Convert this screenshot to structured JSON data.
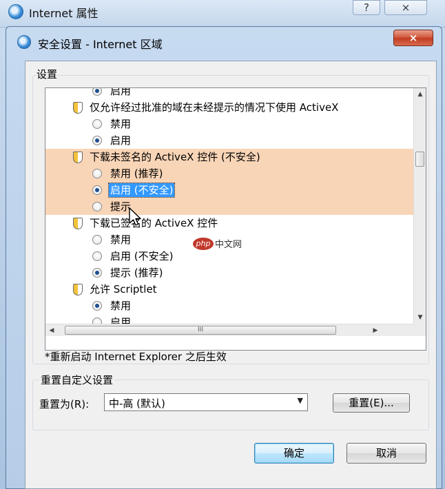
{
  "parent_window": {
    "title": "Internet 属性",
    "help_label": "?",
    "close_label": "×"
  },
  "dialog": {
    "title": "安全设置 - Internet 区域",
    "close_label": "×",
    "settings_label": "设置",
    "items": [
      {
        "type": "option",
        "label": "启用",
        "checked": true
      },
      {
        "type": "setting",
        "label": "仅允许经过批准的域在未经提示的情况下使用 ActiveX",
        "icon": "shield-icon"
      },
      {
        "type": "option",
        "label": "禁用",
        "checked": false
      },
      {
        "type": "option",
        "label": "启用",
        "checked": true
      },
      {
        "type": "setting",
        "label": "下载未签名的 ActiveX 控件 (不安全)",
        "icon": "shield-icon",
        "highlight": true
      },
      {
        "type": "option",
        "label": "禁用 (推荐)",
        "checked": false,
        "highlight": true
      },
      {
        "type": "option",
        "label": "启用 (不安全)",
        "checked": true,
        "highlight": true,
        "selected": true
      },
      {
        "type": "option",
        "label": "提示",
        "checked": false,
        "highlight": true
      },
      {
        "type": "setting",
        "label": "下载已签名的 ActiveX 控件",
        "icon": "shield-icon"
      },
      {
        "type": "option",
        "label": "禁用",
        "checked": false
      },
      {
        "type": "option",
        "label": "启用 (不安全)",
        "checked": false
      },
      {
        "type": "option",
        "label": "提示 (推荐)",
        "checked": true
      },
      {
        "type": "setting",
        "label": "允许 Scriptlet",
        "icon": "shield-icon"
      },
      {
        "type": "option",
        "label": "禁用",
        "checked": true
      },
      {
        "type": "option",
        "label": "启用",
        "checked": false
      }
    ],
    "hscroll_thumb_label": "III",
    "restart_note": "*重新启动 Internet Explorer 之后生效",
    "reset_group_label": "重置自定义设置",
    "reset_to_label": "重置为(R):",
    "reset_level": "中-高 (默认)",
    "reset_button": "重置(E)...",
    "ok_button": "确定",
    "cancel_button": "取消"
  },
  "watermark": {
    "badge": "php",
    "text": "中文网"
  }
}
